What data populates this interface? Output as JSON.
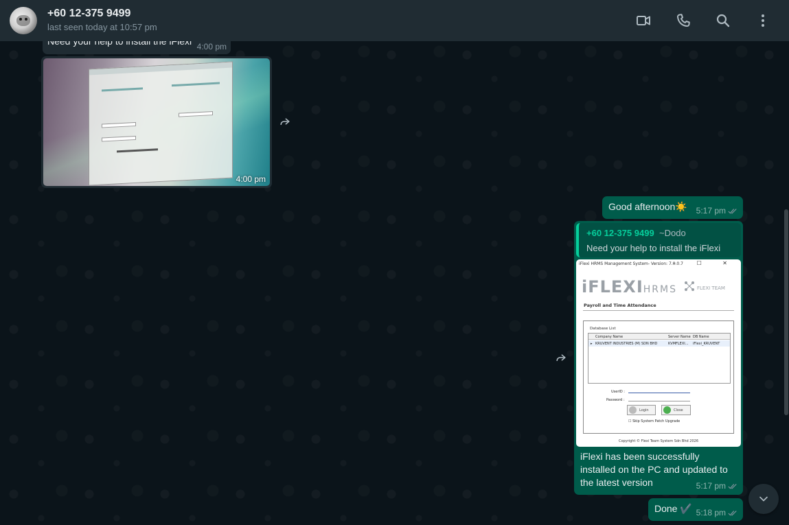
{
  "header": {
    "contact_name": "+60 12-375 9499",
    "status": "last seen today at 10:57 pm",
    "icons": [
      "video-call-icon",
      "voice-call-icon",
      "search-icon",
      "menu-icon"
    ]
  },
  "colors": {
    "header_bg": "#202c33",
    "chat_bg": "#0b141a",
    "incoming_bubble": "#202c33",
    "outgoing_bubble": "#005c4b",
    "accent": "#06cf9c",
    "read_ticks": "#8696a0"
  },
  "messages": [
    {
      "direction": "incoming",
      "type": "text",
      "text": "Need your help to install the iFlexi",
      "time": "4:00 pm"
    },
    {
      "direction": "incoming",
      "type": "image",
      "image_description": "Photo of a monitor showing a remote control app",
      "time": "4:00 pm"
    },
    {
      "direction": "outgoing",
      "type": "text",
      "text": "Good afternoon☀️",
      "time": "5:17 pm",
      "status": "read"
    },
    {
      "direction": "outgoing",
      "type": "image_reply",
      "quote": {
        "author": "+60 12-375 9499",
        "alias": "~Dodo",
        "text": "Need your help to install the iFlexi"
      },
      "screenshot": {
        "window_title": "iFlexi HRMS Management System- Version: 7.0.0.7",
        "window_controls": "–  ☐  ✕",
        "logo": "iFLEXI",
        "logo_suffix": "HRMS",
        "team": "FLEXI TEAM",
        "subtitle": "Payroll and Time Attendance",
        "db_label": "Database List",
        "columns": [
          "Company Name",
          "Server Name",
          "DB Name"
        ],
        "row": [
          "KRUVENT INDUSTRIES (M) SDN BHD",
          "KVMFLEXI...",
          "iFlexi_KRUVENT"
        ],
        "userid_label": "UserID :",
        "password_label": "Password :",
        "login_label": "Login",
        "close_label": "Close",
        "skip_label": "Skip System Patch Upgrade",
        "copyright": "Copyright © Flexi Team System Sdn Bhd 2026"
      },
      "caption": "iFlexi has been successfully installed on the PC and updated to the latest version",
      "time": "5:17 pm",
      "status": "read"
    },
    {
      "direction": "outgoing",
      "type": "text",
      "text": "Done ✔️",
      "time": "5:18 pm",
      "status": "read"
    }
  ]
}
